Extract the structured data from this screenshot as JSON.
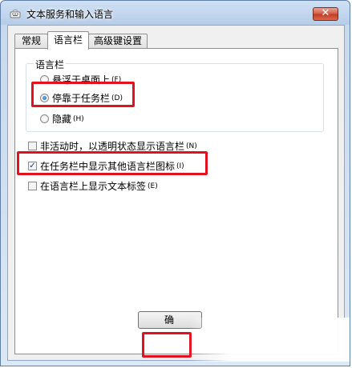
{
  "window": {
    "title": "文本服务和输入语言",
    "app_icon": "keyboard-app-icon",
    "close_label": "✕"
  },
  "tabs": [
    {
      "label": "常规",
      "active": false
    },
    {
      "label": "语言栏",
      "active": true
    },
    {
      "label": "高级键设置",
      "active": false
    }
  ],
  "language_bar_group": {
    "title": "语言栏",
    "options": [
      {
        "label": "悬浮于桌面上",
        "shortcut": "(F)",
        "checked": false
      },
      {
        "label": "停靠于任务栏",
        "shortcut": "(D)",
        "checked": true
      },
      {
        "label": "隐藏",
        "shortcut": "(H)",
        "checked": false
      }
    ]
  },
  "checkboxes": [
    {
      "label": "非活动时，以透明状态显示语言栏",
      "shortcut": "(N)",
      "checked": false
    },
    {
      "label": "在任务栏中显示其他语言栏图标",
      "shortcut": "(I)",
      "checked": true
    },
    {
      "label": "在语言栏上显示文本标签",
      "shortcut": "(E)",
      "checked": false
    }
  ],
  "footer": {
    "ok_label": "确"
  },
  "colors": {
    "highlight": "#e3101e",
    "title_bar": "#b6cde8",
    "close_button": "#c13b22"
  }
}
